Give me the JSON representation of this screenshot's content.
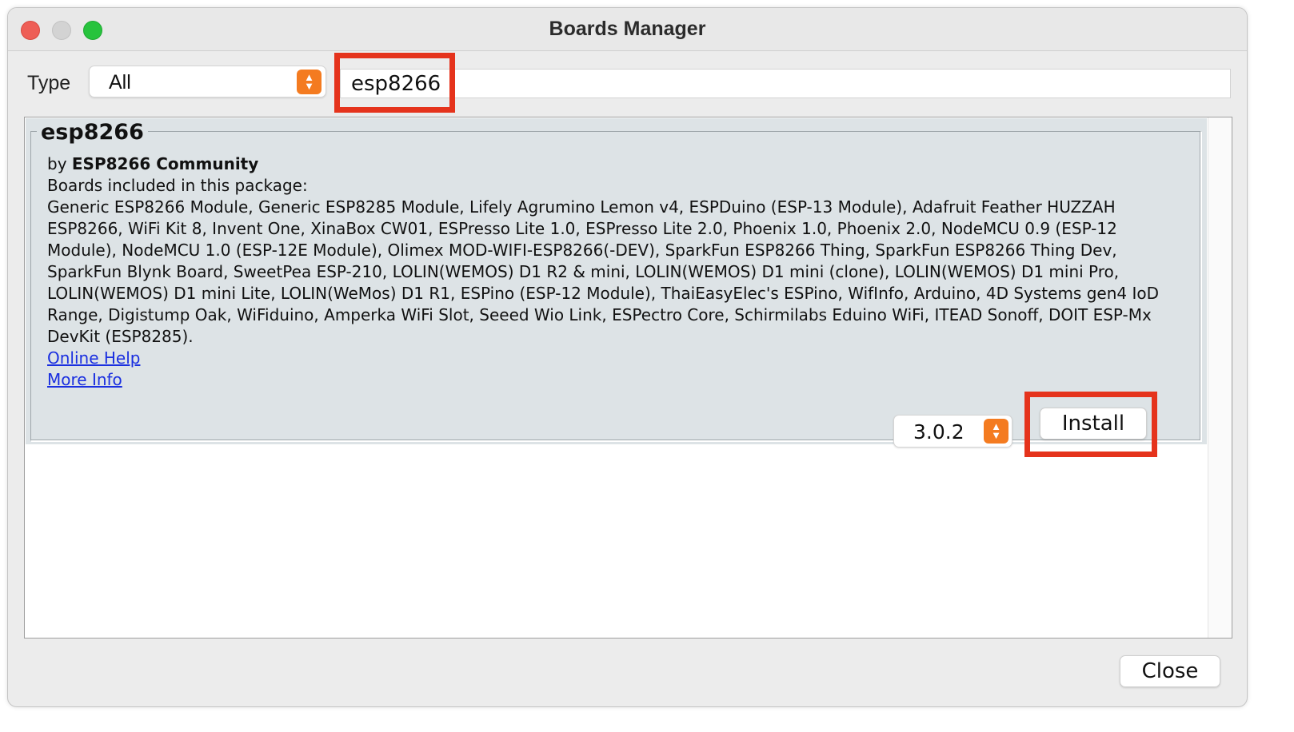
{
  "window": {
    "title": "Boards Manager"
  },
  "filter": {
    "type_label": "Type",
    "type_value": "All",
    "search_value": "esp8266"
  },
  "entry": {
    "name": "esp8266",
    "by_label": "by",
    "author": "ESP8266 Community",
    "boards_label": "Boards included in this package:",
    "boards_text": "Generic ESP8266 Module, Generic ESP8285 Module, Lifely Agrumino Lemon v4, ESPDuino (ESP-13 Module), Adafruit Feather HUZZAH ESP8266, WiFi Kit 8, Invent One, XinaBox CW01, ESPresso Lite 1.0, ESPresso Lite 2.0, Phoenix 1.0, Phoenix 2.0, NodeMCU 0.9 (ESP-12 Module), NodeMCU 1.0 (ESP-12E Module), Olimex MOD-WIFI-ESP8266(-DEV), SparkFun ESP8266 Thing, SparkFun ESP8266 Thing Dev, SparkFun Blynk Board, SweetPea ESP-210, LOLIN(WEMOS) D1 R2 & mini, LOLIN(WEMOS) D1 mini (clone), LOLIN(WEMOS) D1 mini Pro, LOLIN(WEMOS) D1 mini Lite, LOLIN(WeMos) D1 R1, ESPino (ESP-12 Module), ThaiEasyElec's ESPino, WifInfo, Arduino, 4D Systems gen4 IoD Range, Digistump Oak, WiFiduino, Amperka WiFi Slot, Seeed Wio Link, ESPectro Core, Schirmilabs Eduino WiFi, ITEAD Sonoff, DOIT ESP-Mx DevKit (ESP8285).",
    "online_help": "Online Help",
    "more_info": "More Info",
    "version": "3.0.2",
    "install_label": "Install"
  },
  "footer": {
    "close_label": "Close"
  },
  "colors": {
    "highlight": "#e5331c",
    "stepper": "#f47b20",
    "entry_background": "#dde3e6",
    "link": "#1a2fe0"
  }
}
